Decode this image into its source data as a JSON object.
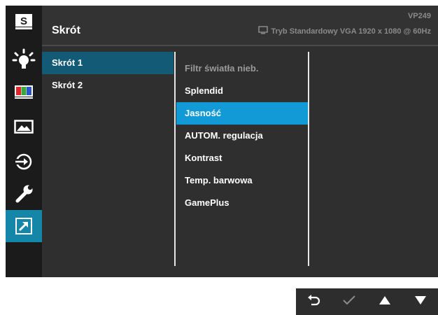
{
  "header": {
    "title": "Skrót",
    "model": "VP249",
    "status": "Tryb Standardowy VGA  1920 x 1080 @ 60Hz",
    "status_icon": "monitor-icon"
  },
  "rail": [
    {
      "icon": "splendid-s-icon",
      "glyph": "S"
    },
    {
      "icon": "blue-light-filter-icon"
    },
    {
      "icon": "color-bars-icon"
    },
    {
      "icon": "image-icon"
    },
    {
      "icon": "input-select-icon"
    },
    {
      "icon": "system-setup-wrench-icon"
    },
    {
      "icon": "shortcut-arrow-icon",
      "active": true
    }
  ],
  "menu": {
    "items": [
      "Skrót 1",
      "Skrót 2"
    ],
    "selected_index": 0
  },
  "submenu": {
    "items": [
      "Filtr światła nieb.",
      "Splendid",
      "Jasność",
      "AUTOM. regulacja",
      "Kontrast",
      "Temp. barwowa",
      "GamePlus"
    ],
    "selected_index": 2,
    "dimmed_index": 0
  },
  "nav_buttons": [
    "back-icon",
    "confirm-check-icon",
    "up-arrow-icon",
    "down-arrow-icon"
  ],
  "colors": {
    "accent_active": "#1486a8",
    "submenu_highlight": "#129ad6",
    "menu_highlight": "#125a76",
    "panel_bg": "#2f2f2f"
  }
}
